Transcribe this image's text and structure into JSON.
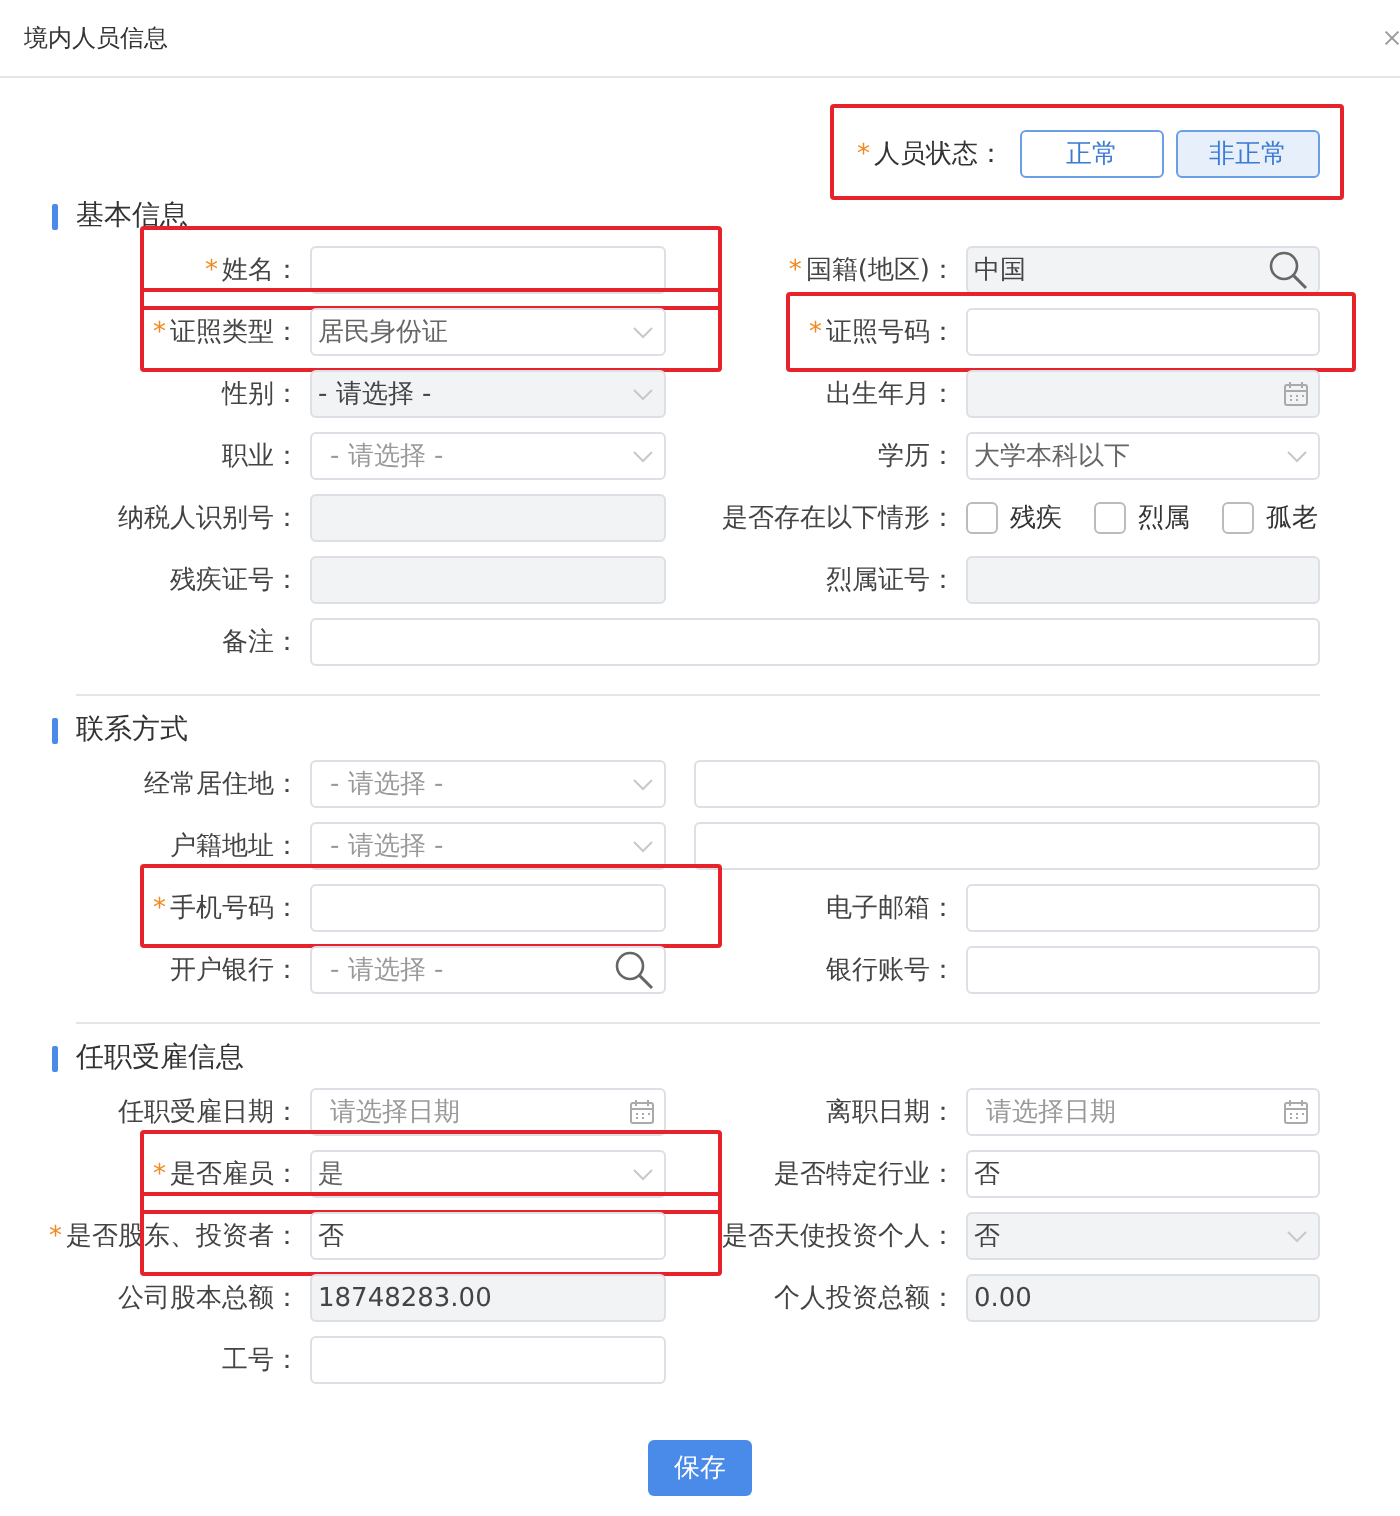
{
  "window": {
    "title": "境内人员信息"
  },
  "status": {
    "label": "人员状态：",
    "mark": "*",
    "highlighted": true,
    "options": [
      {
        "label": "正常",
        "selected": false
      },
      {
        "label": "非正常",
        "selected": true
      }
    ]
  },
  "sections": [
    {
      "title": "基本信息",
      "rows": [
        [
          {
            "label": "姓名：",
            "mark": "*",
            "kind": "text",
            "disabled": false,
            "highlighted": true
          },
          {
            "label": "国籍(地区)：",
            "mark": "*",
            "kind": "search",
            "value": "中国",
            "disabled": true,
            "highlighted": false
          }
        ],
        [
          {
            "label": "证照类型：",
            "mark": "*",
            "kind": "select",
            "value": "居民身份证",
            "disabled": false,
            "highlighted": true
          },
          {
            "label": "证照号码：",
            "mark": "*",
            "kind": "text",
            "disabled": false,
            "highlighted": true
          }
        ],
        [
          {
            "label": "性别：",
            "kind": "select",
            "value": "- 请选择 -",
            "disabled": true,
            "highlighted": false
          },
          {
            "label": "出生年月：",
            "kind": "date",
            "disabled": true,
            "highlighted": false
          }
        ],
        [
          {
            "label": "职业：",
            "kind": "select",
            "placeholder": "- 请选择 -",
            "disabled": false,
            "highlighted": false
          },
          {
            "label": "学历：",
            "kind": "select",
            "value": "大学本科以下",
            "disabled": false,
            "highlighted": false
          }
        ],
        [
          {
            "label": "纳税人识别号：",
            "kind": "text",
            "disabled": true,
            "highlighted": false
          },
          {
            "label": "是否存在以下情形：",
            "kind": "checks",
            "highlighted": false,
            "options": [
              {
                "label": "残疾",
                "checked": false
              },
              {
                "label": "烈属",
                "checked": false
              },
              {
                "label": "孤老",
                "checked": false
              }
            ]
          }
        ],
        [
          {
            "label": "残疾证号：",
            "kind": "text",
            "disabled": true,
            "highlighted": false
          },
          {
            "label": "烈属证号：",
            "kind": "text",
            "disabled": true,
            "highlighted": false
          }
        ],
        [
          {
            "label": "备注：",
            "kind": "wide",
            "disabled": false,
            "highlighted": false
          }
        ]
      ]
    },
    {
      "title": "联系方式",
      "rows": [
        [
          {
            "label": "经常居住地：",
            "kind": "select",
            "placeholder": "- 请选择 -",
            "disabled": false,
            "highlighted": false
          },
          {
            "kind": "text",
            "disabled": false,
            "highlighted": false
          }
        ],
        [
          {
            "label": "户籍地址：",
            "kind": "select",
            "placeholder": "- 请选择 -",
            "disabled": false,
            "highlighted": false
          },
          {
            "kind": "text",
            "disabled": false,
            "highlighted": false
          }
        ],
        [
          {
            "label": "手机号码：",
            "mark": "*",
            "kind": "text",
            "disabled": false,
            "highlighted": true
          },
          {
            "label": "电子邮箱：",
            "kind": "text",
            "disabled": false,
            "highlighted": false
          }
        ],
        [
          {
            "label": "开户银行：",
            "kind": "search",
            "placeholder": "- 请选择 -",
            "disabled": false,
            "highlighted": false
          },
          {
            "label": "银行账号：",
            "kind": "text",
            "disabled": false,
            "highlighted": false
          }
        ]
      ]
    },
    {
      "title": "任职受雇信息",
      "rows": [
        [
          {
            "label": "任职受雇日期：",
            "kind": "date",
            "placeholder": "请选择日期",
            "disabled": false,
            "highlighted": false
          },
          {
            "label": "离职日期：",
            "kind": "date",
            "placeholder": "请选择日期",
            "disabled": false,
            "highlighted": false
          }
        ],
        [
          {
            "label": "是否雇员：",
            "mark": "*",
            "kind": "select",
            "value": "是",
            "disabled": false,
            "highlighted": true
          },
          {
            "label": "是否特定行业：",
            "kind": "text",
            "value": "否",
            "disabled": false,
            "highlighted": false
          }
        ],
        [
          {
            "label": "是否股东、投资者：",
            "mark": "*",
            "kind": "text",
            "value": "否",
            "disabled": false,
            "highlighted": true
          },
          {
            "label": "是否天使投资个人：",
            "kind": "select",
            "value": "否",
            "disabled": true,
            "highlighted": false
          }
        ],
        [
          {
            "label": "公司股本总额：",
            "kind": "text",
            "value": "18748283.00",
            "disabled": true,
            "highlighted": false
          },
          {
            "label": "个人投资总额：",
            "kind": "text",
            "value": "0.00",
            "disabled": true,
            "highlighted": false
          }
        ],
        [
          {
            "label": "工号：",
            "kind": "text",
            "disabled": false,
            "highlighted": false
          }
        ]
      ]
    }
  ],
  "save_button": "保存"
}
